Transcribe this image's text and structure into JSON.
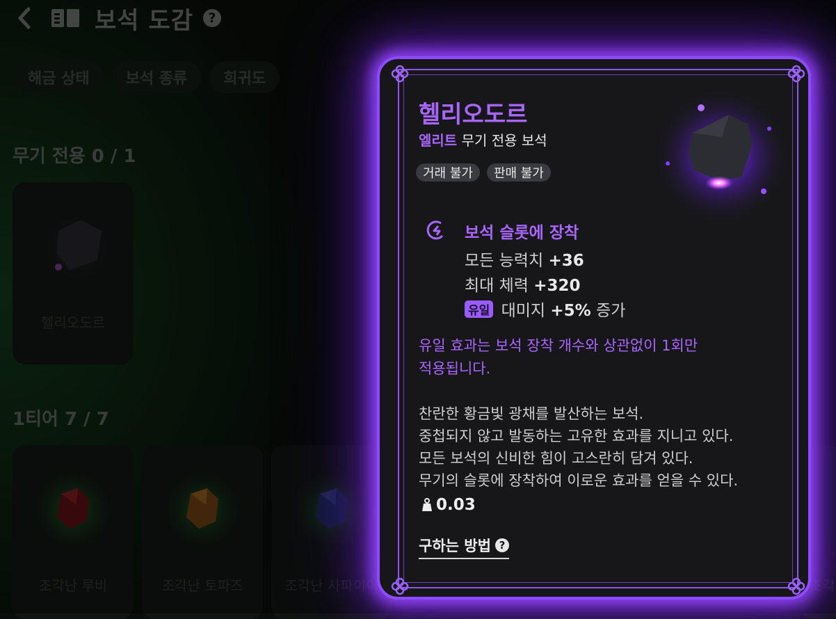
{
  "header": {
    "title": "보석 도감",
    "help_symbol": "?"
  },
  "filters": [
    {
      "label": "해금 상태"
    },
    {
      "label": "보석 종류"
    },
    {
      "label": "희귀도"
    }
  ],
  "sections": {
    "weapon_only": {
      "title": "무기 전용 0 / 1",
      "cards": [
        {
          "name": "헬리오도르"
        }
      ]
    },
    "tier1": {
      "title": "1티어 7 / 7",
      "cards": [
        {
          "name": "조각난 루비"
        },
        {
          "name": "조각난 토파즈"
        },
        {
          "name": "조각난 사파이어"
        }
      ],
      "partial_card_label": "조각"
    }
  },
  "popup": {
    "name": "헬리오도르",
    "grade": "엘리트",
    "type": "무기 전용 보석",
    "tags": [
      "거래 불가",
      "판매 불가"
    ],
    "slot_title": "보석 슬롯에 장착",
    "stats": [
      {
        "label": "모든 능력치",
        "value": "+36"
      },
      {
        "label": "최대 체력",
        "value": "+320"
      }
    ],
    "unique_stat": {
      "badge": "유일",
      "label": "대미지",
      "value": "+5%",
      "suffix": "증가"
    },
    "note_line1": "유일 효과는 보석 장착 개수와 상관없이 1회만",
    "note_line2": "적용됩니다.",
    "description": [
      "찬란한 황금빛 광채를 발산하는 보석.",
      "중첩되지 않고 발동하는 고유한 효과를 지니고 있다.",
      "모든 보석의 신비한 힘이 고스란히 담겨 있다.",
      "무기의 슬롯에 장착하여 이로운 효과를 얻을 수 있다."
    ],
    "weight": "0.03",
    "how_to_get": "구하는 방법",
    "how_symbol": "?"
  },
  "colors": {
    "accent": "#a866ff",
    "glow": "#8c4bff"
  }
}
